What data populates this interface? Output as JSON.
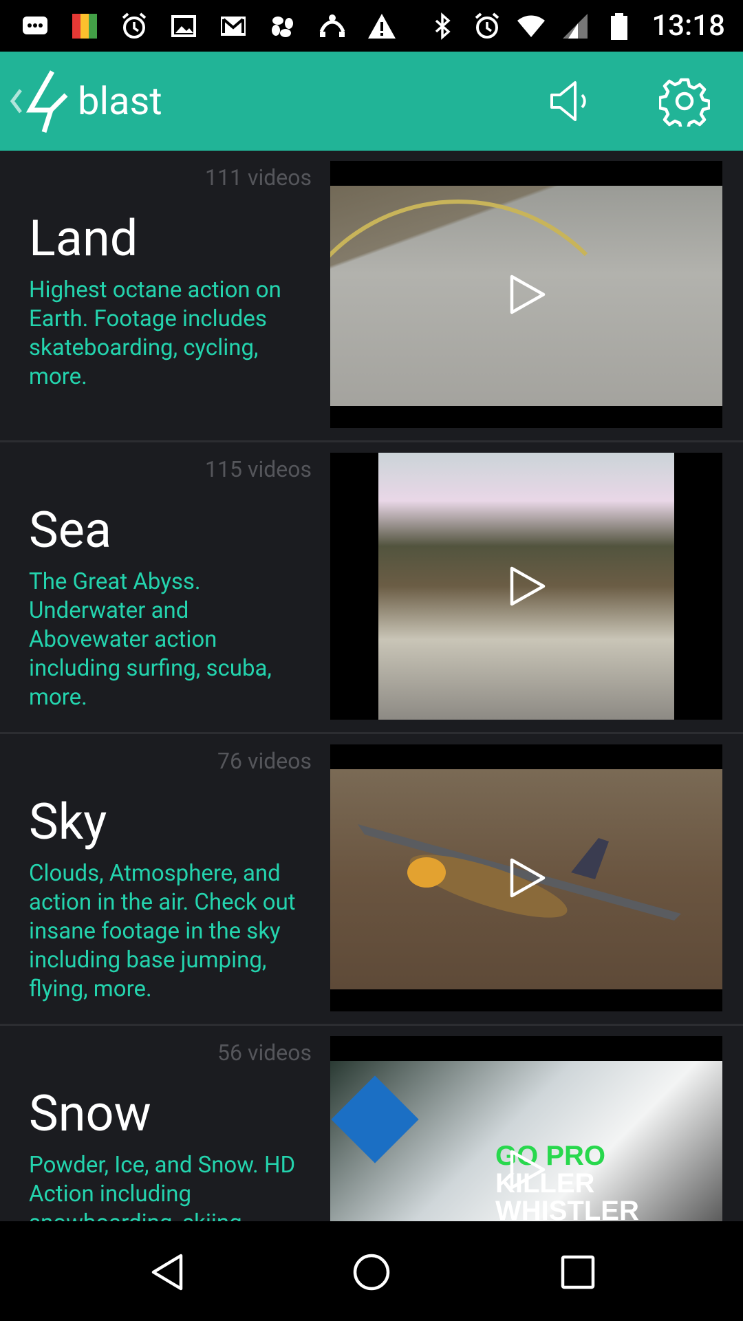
{
  "status_bar": {
    "time": "13:18",
    "left_icons": [
      "chat-icon",
      "avg-antivirus-icon",
      "alarm-icon",
      "image-icon",
      "gmail-icon",
      "pinwheel-icon",
      "vpn-icon",
      "warning-icon"
    ],
    "right_icons": [
      "bluetooth-icon",
      "alarm-icon",
      "wifi-icon",
      "cell-signal-icon",
      "battery-icon"
    ]
  },
  "app_bar": {
    "title": "blast",
    "actions": [
      "volume-icon",
      "settings-icon"
    ],
    "accent_color": "#21b497"
  },
  "categories": [
    {
      "count": "111 videos",
      "title": "Land",
      "description": "Highest octane action on Earth.  Footage includes skateboarding, cycling, more."
    },
    {
      "count": "115 videos",
      "title": "Sea",
      "description": "The Great Abyss. Underwater and Abovewater action including surfing, scuba, more."
    },
    {
      "count": "76 videos",
      "title": "Sky",
      "description": "Clouds, Atmosphere, and action in the air. Check out insane footage in the sky including base jumping, flying, more."
    },
    {
      "count": "56 videos",
      "title": "Snow",
      "description": "Powder, Ice, and Snow. HD Action including snowboarding, skiing, more."
    }
  ],
  "snow_thumb_text": {
    "line1": "GO PRO",
    "line2": "KILLER",
    "line3": "WHISTLER"
  },
  "nav_bar": [
    "back-icon",
    "home-icon",
    "recents-icon"
  ],
  "colors": {
    "background": "#1b1c20",
    "description_text": "#24d4ae",
    "count_text": "#55565b"
  }
}
